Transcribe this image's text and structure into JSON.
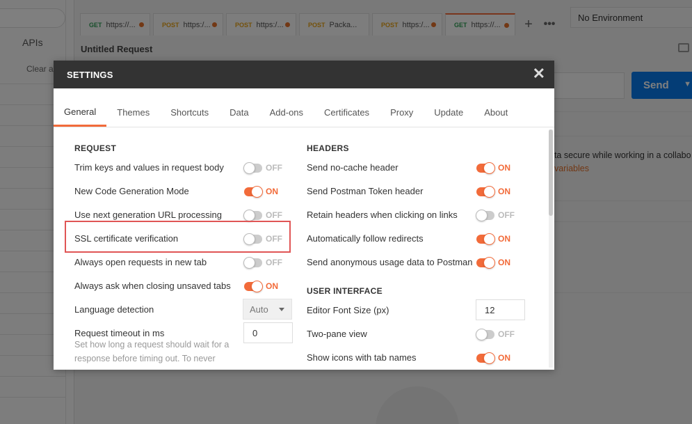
{
  "background": {
    "sidebar": {
      "apis": "APIs",
      "clear": "Clear a"
    },
    "tabs": [
      {
        "method": "GET",
        "url": "https://..."
      },
      {
        "method": "POST",
        "url": "https:/..."
      },
      {
        "method": "POST",
        "url": "https:/..."
      },
      {
        "method": "POST",
        "url": "Packa..."
      },
      {
        "method": "POST",
        "url": "https:/..."
      },
      {
        "method": "GET",
        "url": "https://..."
      }
    ],
    "plus": "+",
    "more": "•••",
    "environment": "No Environment",
    "request_title": "Untitled Request",
    "send_label": "Send",
    "notice_line1": "ata secure while working in a collabo",
    "notice_line2": "t variables"
  },
  "modal": {
    "title": "SETTINGS",
    "close": "✕",
    "tabs": [
      "General",
      "Themes",
      "Shortcuts",
      "Data",
      "Add-ons",
      "Certificates",
      "Proxy",
      "Update",
      "About"
    ],
    "active_tab": "General",
    "request": {
      "heading": "REQUEST",
      "items": [
        {
          "label": "Trim keys and values in request body",
          "state": "OFF"
        },
        {
          "label": "New Code Generation Mode",
          "state": "ON"
        },
        {
          "label": "Use next generation URL processing",
          "state": "OFF"
        },
        {
          "label": "SSL certificate verification",
          "state": "OFF"
        },
        {
          "label": "Always open requests in new tab",
          "state": "OFF"
        },
        {
          "label": "Always ask when closing unsaved tabs",
          "state": "ON"
        }
      ],
      "language_detection": {
        "label": "Language detection",
        "value": "Auto"
      },
      "timeout": {
        "label": "Request timeout in ms",
        "value": "0",
        "help": "Set how long a request should wait for a response before timing out. To never"
      }
    },
    "headers": {
      "heading": "HEADERS",
      "items": [
        {
          "label": "Send no-cache header",
          "state": "ON"
        },
        {
          "label": "Send Postman Token header",
          "state": "ON"
        },
        {
          "label": "Retain headers when clicking on links",
          "state": "OFF"
        },
        {
          "label": "Automatically follow redirects",
          "state": "ON"
        },
        {
          "label": "Send anonymous usage data to Postman",
          "state": "ON"
        }
      ]
    },
    "user_interface": {
      "heading": "USER INTERFACE",
      "font_size": {
        "label": "Editor Font Size (px)",
        "value": "12"
      },
      "items": [
        {
          "label": "Two-pane view",
          "state": "OFF"
        },
        {
          "label": "Show icons with tab names",
          "state": "ON"
        }
      ]
    }
  },
  "colors": {
    "accent": "#f26b3a",
    "send": "#097bed",
    "highlight": "#e05555"
  }
}
